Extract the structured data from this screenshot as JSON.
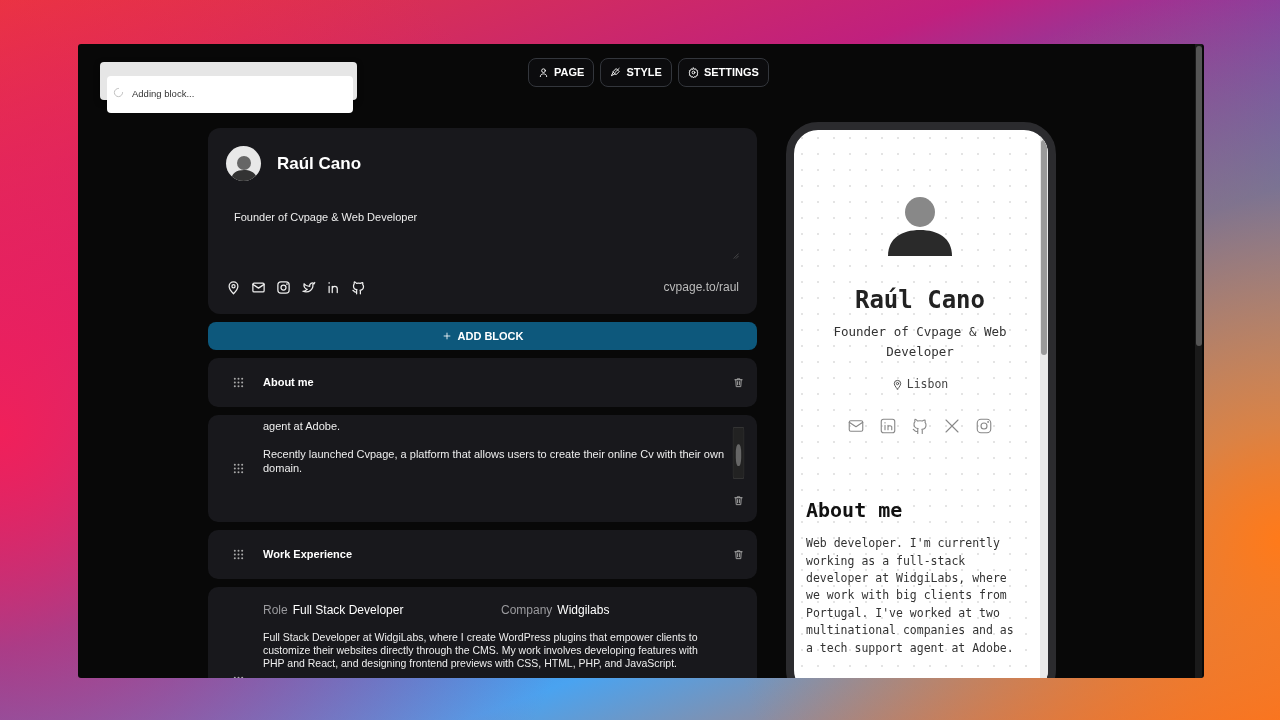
{
  "toast": {
    "text": "Adding block..."
  },
  "toolbar": [
    {
      "label": "PAGE"
    },
    {
      "label": "STYLE"
    },
    {
      "label": "SETTINGS"
    }
  ],
  "profile": {
    "name": "Raúl Cano",
    "bio": "Founder of Cvpage & Web Developer",
    "url": "cvpage.to/raul"
  },
  "add_block": {
    "label": "ADD BLOCK"
  },
  "blocks": [
    {
      "kind": "header",
      "title": "About me"
    },
    {
      "kind": "text",
      "paragraphs": [
        "agent at Adobe.",
        "Recently launched Cvpage, a platform that allows users to create their online Cv with their own domain."
      ]
    },
    {
      "kind": "header",
      "title": "Work Experience"
    },
    {
      "kind": "job",
      "role_label": "Role",
      "role": "Full Stack Developer",
      "company_label": "Company",
      "company": "Widgilabs",
      "description": "Full Stack Developer at WidgiLabs, where I create WordPress plugins that empower clients to customize their websites directly through the CMS. My work involves developing features with PHP and React, and designing frontend previews with CSS, HTML, PHP, and JavaScript."
    }
  ],
  "preview": {
    "name": "Raúl Cano",
    "tagline": "Founder of Cvpage & Web Developer",
    "location": "Lisbon",
    "section_title": "About me",
    "section_text": "Web developer. I'm currently working as a full-stack developer at WidgiLabs, where we work with big clients from Portugal. I've worked at two multinational companies and as a tech support agent at Adobe."
  }
}
